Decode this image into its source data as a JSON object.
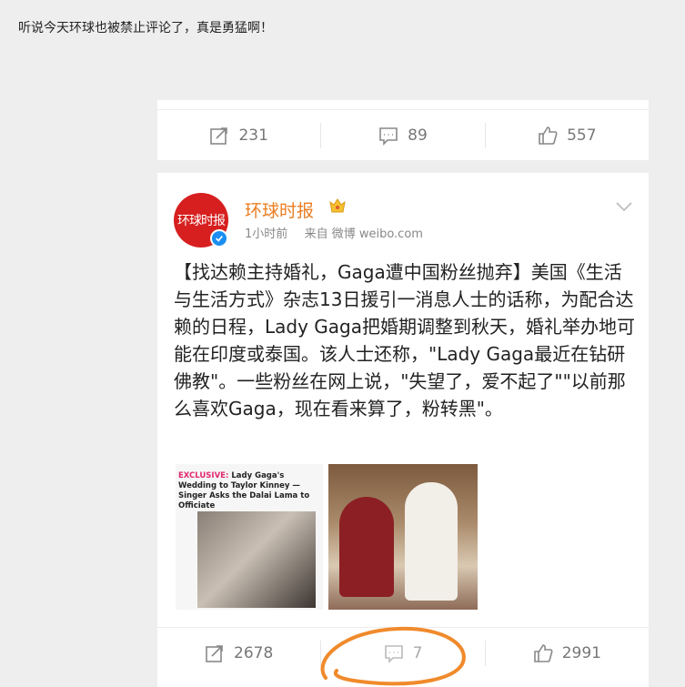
{
  "caption": "听说今天环球也被禁止评论了，真是勇猛啊！",
  "prev_post": {
    "actions": {
      "repost_icon": "repost-icon",
      "repost_count": "231",
      "comment_icon": "comment-icon",
      "comment_count": "89",
      "like_icon": "like-icon",
      "like_count": "557"
    }
  },
  "post": {
    "author": "环球时报",
    "avatar_text": "环球时报",
    "time": "1小时前",
    "source": "来自 微博 weibo.com",
    "text": "【找达赖主持婚礼，Gaga遭中国粉丝抛弃】美国《生活与生活方式》杂志13日援引一消息人士的话称，为配合达赖的日程，Lady Gaga把婚期调整到秋天，婚礼举办地可能在印度或泰国。该人士还称，\"Lady Gaga最近在钻研佛教\"。一些粉丝在网上说，\"失望了，爱不起了\"\"以前那么喜欢Gaga，现在看来算了，粉转黑\"。",
    "image1": {
      "exclusive": "EXCLUSIVE:",
      "headline": " Lady Gaga's Wedding to Taylor Kinney — Singer Asks the Dalai Lama to Officiate"
    },
    "actions": {
      "repost_count": "2678",
      "comment_count": "7",
      "like_count": "2991"
    }
  },
  "colors": {
    "author": "#eb7d22",
    "avatar_bg": "#d71f1f",
    "verified": "#1a8ef2",
    "scribble": "#f08a2c"
  }
}
